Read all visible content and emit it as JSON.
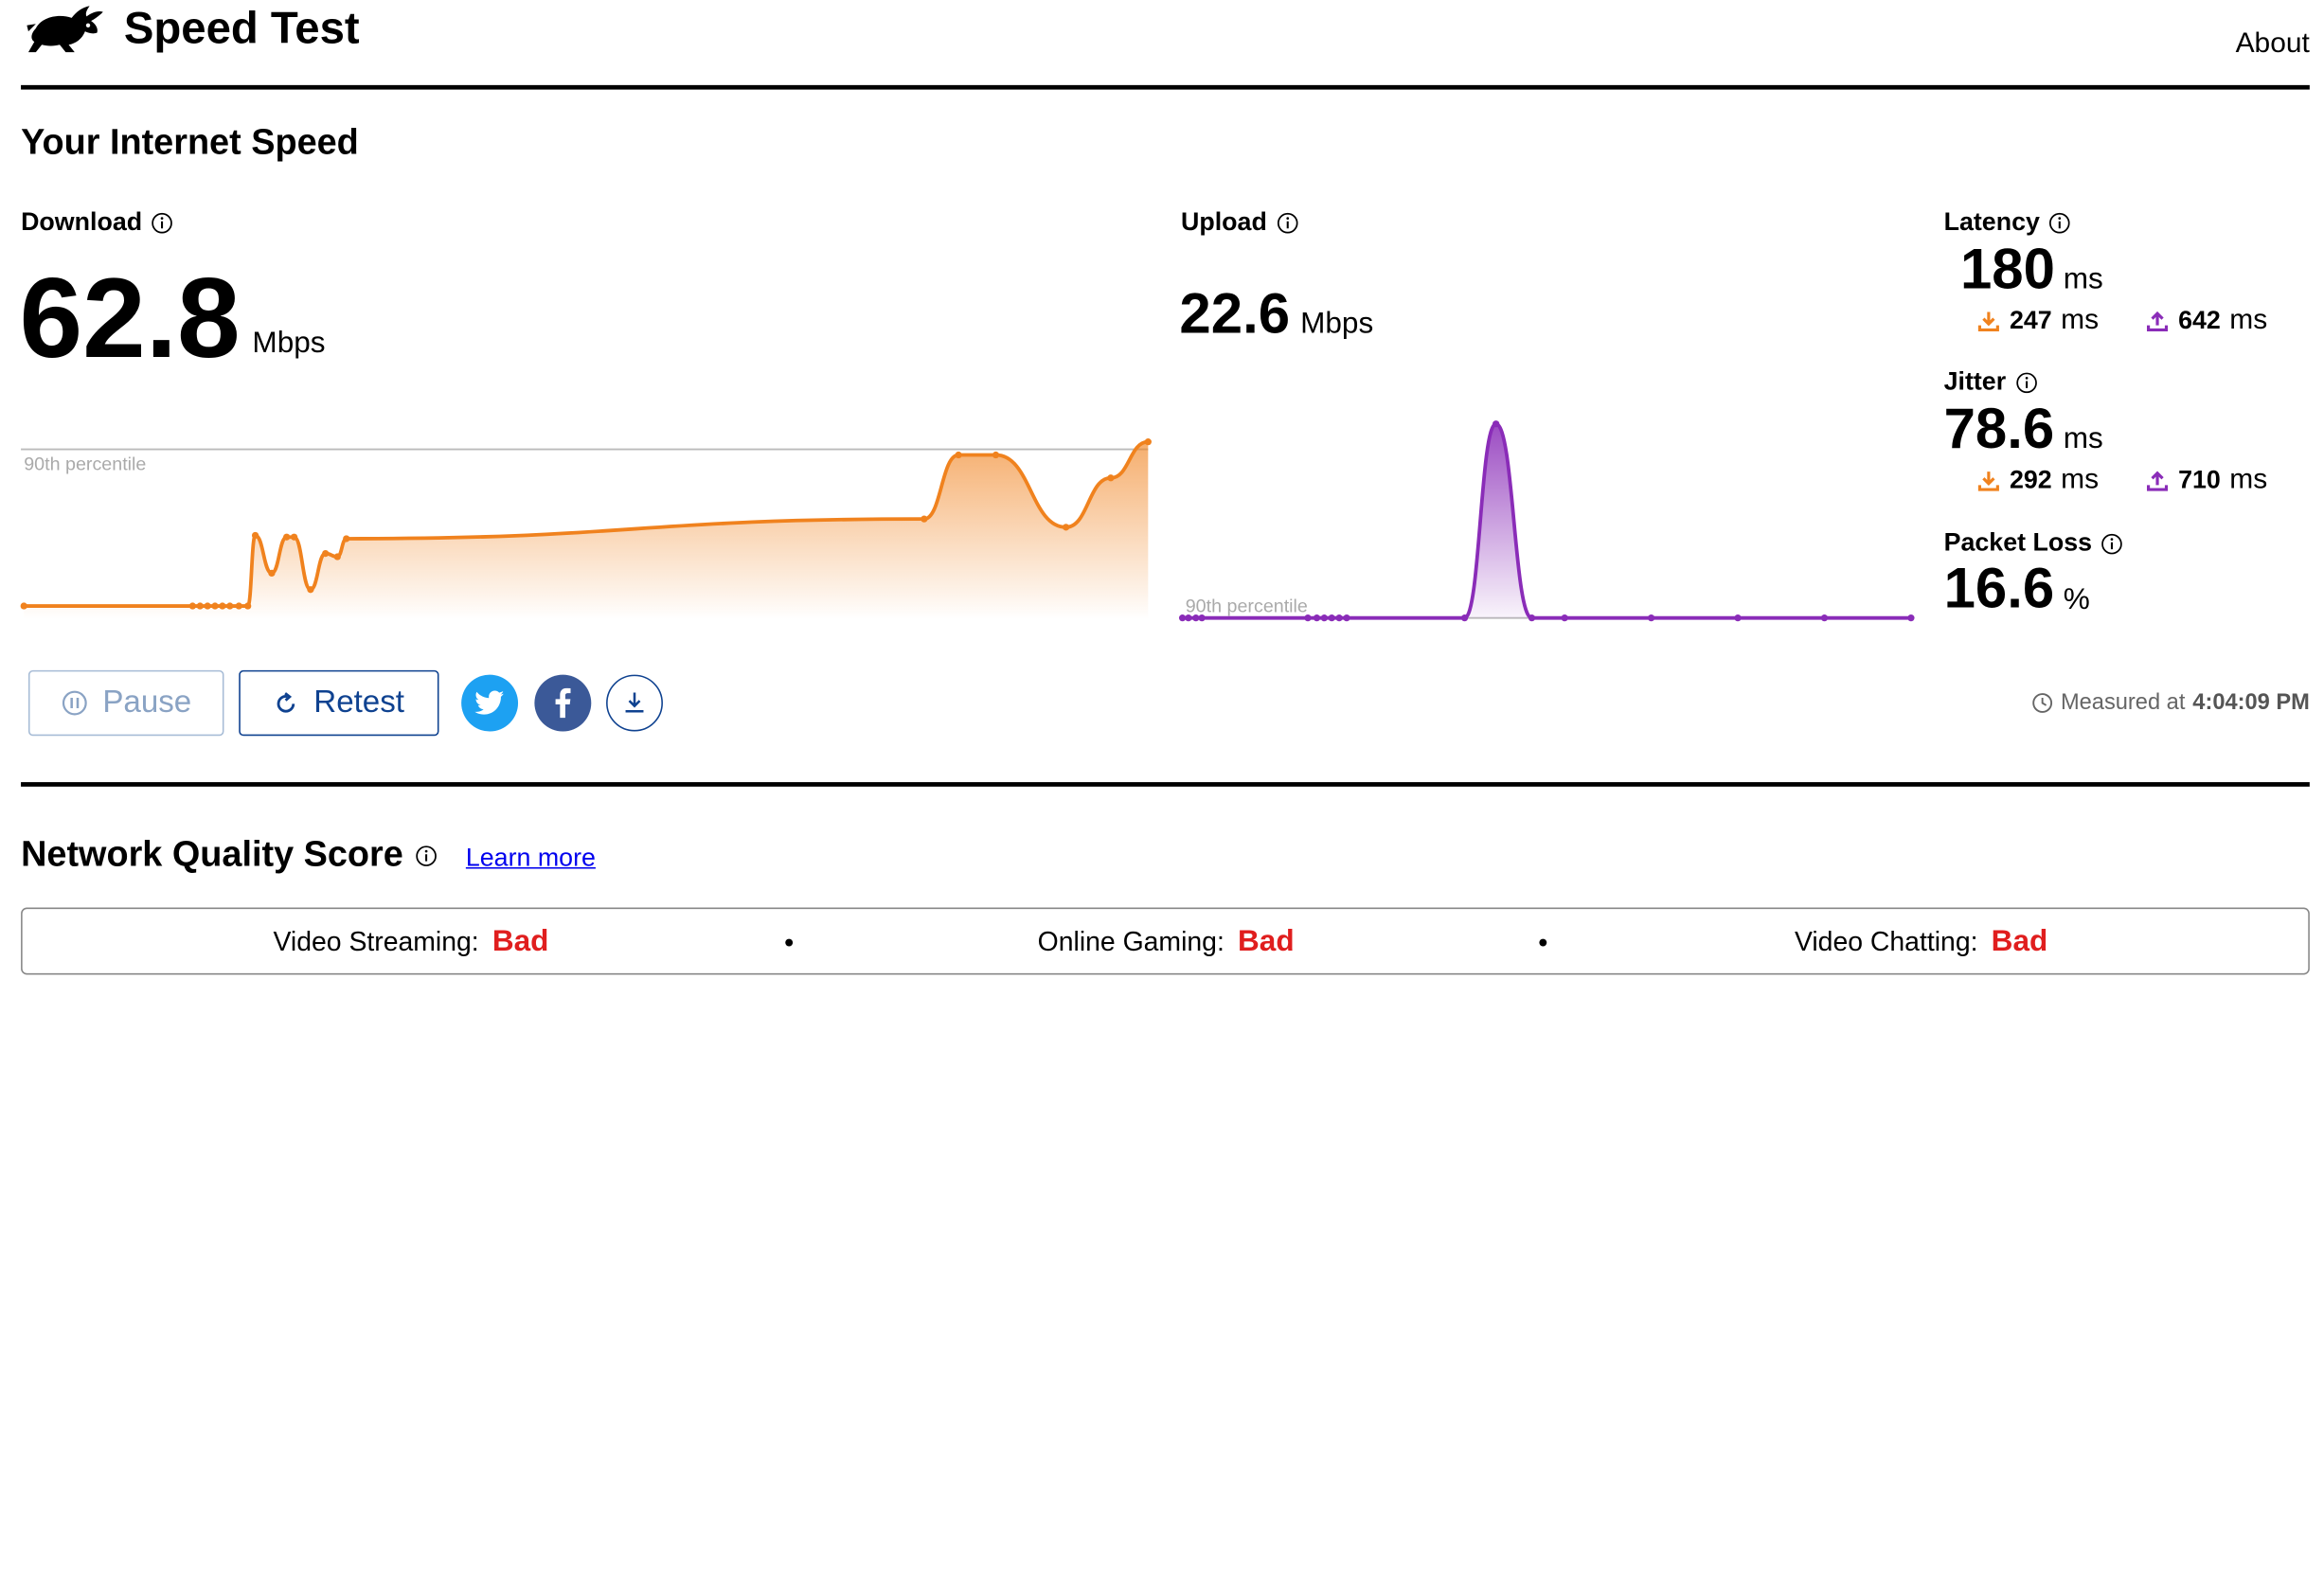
{
  "header": {
    "title": "Speed Test",
    "about_label": "About"
  },
  "section_title": "Your Internet Speed",
  "download": {
    "label": "Download",
    "value": "62.8",
    "unit": "Mbps",
    "percentile_label": "90th percentile",
    "color": "#f0821e"
  },
  "upload": {
    "label": "Upload",
    "value": "22.6",
    "unit": "Mbps",
    "percentile_label": "90th percentile",
    "color": "#8a2cb8"
  },
  "latency": {
    "label": "Latency",
    "value": "180",
    "unit": "ms",
    "down_value": "247",
    "down_unit": "ms",
    "up_value": "642",
    "up_unit": "ms"
  },
  "jitter": {
    "label": "Jitter",
    "value": "78.6",
    "unit": "ms",
    "down_value": "292",
    "down_unit": "ms",
    "up_value": "710",
    "up_unit": "ms"
  },
  "packet_loss": {
    "label": "Packet Loss",
    "value": "16.6",
    "unit": "%"
  },
  "controls": {
    "pause_label": "Pause",
    "retest_label": "Retest",
    "share_icons": [
      "twitter-icon",
      "facebook-icon",
      "download-icon"
    ]
  },
  "measured": {
    "prefix": "Measured at",
    "time": "4:04:09 PM"
  },
  "network_quality": {
    "title": "Network Quality Score",
    "learn_more_label": "Learn more",
    "items": [
      {
        "label": "Video Streaming:",
        "value": "Bad"
      },
      {
        "label": "Online Gaming:",
        "value": "Bad"
      },
      {
        "label": "Video Chatting:",
        "value": "Bad"
      }
    ]
  },
  "chart_data": [
    {
      "type": "area",
      "series": [
        {
          "name": "Download",
          "color": "#f0821e"
        }
      ],
      "x": [
        0,
        1,
        2,
        3,
        4,
        5,
        6,
        7,
        8,
        9,
        10,
        11,
        12,
        13,
        14,
        15,
        16,
        17,
        18,
        19,
        20,
        21,
        22,
        23
      ],
      "values": [
        0,
        0,
        0,
        0,
        0,
        0,
        0,
        0,
        0.43,
        0.2,
        0.42,
        0.42,
        0.1,
        0.32,
        0.3,
        0.41,
        0.53,
        0.92,
        0.92,
        0.48,
        0.78,
        1.0
      ],
      "reference_line": "90th percentile"
    },
    {
      "type": "area",
      "series": [
        {
          "name": "Upload",
          "color": "#8a2cb8"
        }
      ],
      "values": [
        0,
        0,
        0,
        0,
        0,
        0,
        0,
        0,
        0,
        0,
        0,
        1.0,
        0,
        0,
        0,
        0,
        0,
        0
      ],
      "reference_line": "90th percentile"
    }
  ]
}
